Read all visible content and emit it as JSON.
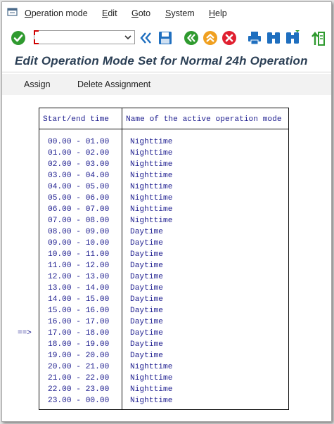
{
  "menubar": {
    "items": [
      {
        "label": "Operation mode",
        "mnemonic": "O"
      },
      {
        "label": "Edit",
        "mnemonic": "E"
      },
      {
        "label": "Goto",
        "mnemonic": "G"
      },
      {
        "label": "System",
        "mnemonic": "S"
      },
      {
        "label": "Help",
        "mnemonic": "H"
      }
    ]
  },
  "toolbar": {
    "command_field_value": "",
    "icons": [
      "enter-check-icon",
      "command-dropdown-icon",
      "collapse-left-icon",
      "save-icon",
      "back-icon",
      "exit-icon",
      "cancel-icon",
      "print-icon",
      "find-icon",
      "find-next-icon",
      "first-page-icon"
    ],
    "colors": {
      "green": "#2f9a2f",
      "orange": "#f0a020",
      "red": "#e02030",
      "blue": "#1f6fbf"
    }
  },
  "title": "Edit Operation Mode Set for Normal 24h Operation",
  "appbar": {
    "assign_label": "Assign",
    "delete_label": "Delete Assignment"
  },
  "table": {
    "headers": {
      "time": "Start/end time",
      "mode": "Name of the active operation mode"
    },
    "marker": "==>",
    "marker_row_index": 17,
    "rows": [
      {
        "time": "00.00 - 01.00",
        "mode": "Nighttime"
      },
      {
        "time": "01.00 - 02.00",
        "mode": "Nighttime"
      },
      {
        "time": "02.00 - 03.00",
        "mode": "Nighttime"
      },
      {
        "time": "03.00 - 04.00",
        "mode": "Nighttime"
      },
      {
        "time": "04.00 - 05.00",
        "mode": "Nighttime"
      },
      {
        "time": "05.00 - 06.00",
        "mode": "Nighttime"
      },
      {
        "time": "06.00 - 07.00",
        "mode": "Nighttime"
      },
      {
        "time": "07.00 - 08.00",
        "mode": "Nighttime"
      },
      {
        "time": "08.00 - 09.00",
        "mode": "Daytime"
      },
      {
        "time": "09.00 - 10.00",
        "mode": "Daytime"
      },
      {
        "time": "10.00 - 11.00",
        "mode": "Daytime"
      },
      {
        "time": "11.00 - 12.00",
        "mode": "Daytime"
      },
      {
        "time": "12.00 - 13.00",
        "mode": "Daytime"
      },
      {
        "time": "13.00 - 14.00",
        "mode": "Daytime"
      },
      {
        "time": "14.00 - 15.00",
        "mode": "Daytime"
      },
      {
        "time": "15.00 - 16.00",
        "mode": "Daytime"
      },
      {
        "time": "16.00 - 17.00",
        "mode": "Daytime"
      },
      {
        "time": "17.00 - 18.00",
        "mode": "Daytime"
      },
      {
        "time": "18.00 - 19.00",
        "mode": "Daytime"
      },
      {
        "time": "19.00 - 20.00",
        "mode": "Daytime"
      },
      {
        "time": "20.00 - 21.00",
        "mode": "Nighttime"
      },
      {
        "time": "21.00 - 22.00",
        "mode": "Nighttime"
      },
      {
        "time": "22.00 - 23.00",
        "mode": "Nighttime"
      },
      {
        "time": "23.00 - 00.00",
        "mode": "Nighttime"
      }
    ]
  }
}
